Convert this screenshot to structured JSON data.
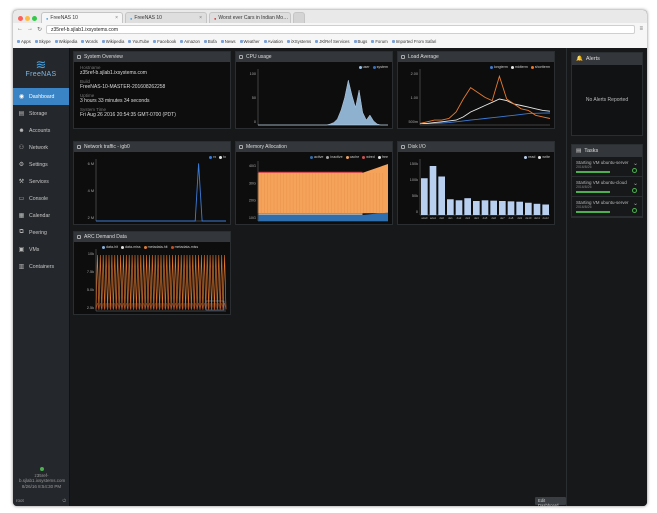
{
  "browser": {
    "tabs": [
      {
        "label": "FreeNAS 10",
        "active": true
      },
      {
        "label": "FreeNAS 10",
        "active": false
      },
      {
        "label": "Worst ever Cars in Indian Mo…",
        "active": false
      }
    ],
    "url": "z35ref-b.sjlab1.ixsystems.com",
    "bookmarks": [
      "Apps",
      "Skype",
      "Wikipedia",
      "Words",
      "Wikipedia",
      "YouTube",
      "Facebook",
      "Amazon",
      "Bofa",
      "News",
      "Weather",
      "Aviation",
      "iXSystems",
      "JKlRef Services",
      "Bugs",
      "Forum",
      "Imported From Safari"
    ]
  },
  "sidebar": {
    "logo": "FreeNAS",
    "items": [
      {
        "label": "Dashboard",
        "icon": "dashboard-icon",
        "glyph": "◉",
        "active": true
      },
      {
        "label": "Storage",
        "icon": "storage-icon",
        "glyph": "▤"
      },
      {
        "label": "Accounts",
        "icon": "accounts-icon",
        "glyph": "☻"
      },
      {
        "label": "Network",
        "icon": "network-icon",
        "glyph": "⚇"
      },
      {
        "label": "Settings",
        "icon": "settings-icon",
        "glyph": "⚙"
      },
      {
        "label": "Services",
        "icon": "services-icon",
        "glyph": "⚒"
      },
      {
        "label": "Console",
        "icon": "console-icon",
        "glyph": "▭"
      },
      {
        "label": "Calendar",
        "icon": "calendar-icon",
        "glyph": "▦"
      },
      {
        "label": "Peering",
        "icon": "peering-icon",
        "glyph": "⧉"
      },
      {
        "label": "VMs",
        "icon": "vms-icon",
        "glyph": "▣"
      },
      {
        "label": "Containers",
        "icon": "containers-icon",
        "glyph": "▥"
      }
    ],
    "host": "z35ref-b.sjlab1.ixsystems.com",
    "time": "8/26/16  8:54:30 PM",
    "user": "root"
  },
  "overview": {
    "title": "System Overview",
    "hostname_label": "Hostname",
    "hostname": "z35ref-b.sjlab1.ixsystems.com",
    "build_label": "Build",
    "build": "FreeNAS-10-MASTER-201608262258",
    "uptime_label": "Uptime",
    "uptime": "3 hours 33 minutes 34 seconds",
    "systime_label": "System Time",
    "systime": "Fri Aug 26 2016 20:54:35 GMT-0700 (PDT)"
  },
  "widgets": {
    "cpu": "CPU usage",
    "load": "Load Average",
    "net": "Network traffic - igb0",
    "mem": "Memory Allocation",
    "disk": "Disk I/O",
    "arc": "ARC Demand Data"
  },
  "chart_data": [
    {
      "type": "area",
      "title": "CPU usage",
      "series": [
        {
          "name": "user"
        },
        {
          "name": "system"
        }
      ],
      "ytick_labels": [
        "100",
        "50",
        "0"
      ],
      "values": [
        0,
        0,
        0,
        0,
        0,
        0,
        0,
        0,
        0,
        0,
        0,
        0,
        0,
        0,
        0,
        0,
        0,
        0,
        0,
        0,
        2,
        5,
        12,
        30,
        55,
        90,
        60,
        35,
        70,
        25,
        10,
        20,
        8,
        2,
        0,
        0,
        0
      ],
      "color": "#9ec3e6"
    },
    {
      "type": "line",
      "title": "Load Average",
      "series": [
        {
          "name": "longterm",
          "color": "#3d7bd6",
          "values": [
            0.1,
            0.1,
            0.1,
            0.12,
            0.15,
            0.2,
            0.25,
            0.3,
            0.35,
            0.4,
            0.45,
            0.5,
            0.55,
            0.6,
            0.65,
            0.7,
            0.72,
            0.73,
            0.74
          ]
        },
        {
          "name": "midterm",
          "color": "#e8e8e8",
          "values": [
            0.1,
            0.1,
            0.15,
            0.2,
            0.25,
            0.3,
            0.5,
            0.8,
            1.0,
            1.2,
            1.4,
            1.6,
            1.5,
            1.3,
            1.2,
            1.1,
            1.0,
            0.9,
            0.85
          ]
        },
        {
          "name": "shortterm",
          "color": "#e67a2e",
          "values": [
            0.1,
            0.2,
            0.3,
            0.3,
            0.4,
            0.8,
            1.6,
            2.3,
            2.0,
            1.7,
            1.5,
            3.0,
            1.6,
            1.3,
            1.0,
            0.9,
            0.6,
            0.5,
            0.4
          ]
        }
      ],
      "ytick_labels": [
        "2.00",
        "1.00",
        "500m"
      ]
    },
    {
      "type": "line",
      "title": "Network traffic - igb0",
      "series": [
        {
          "name": "rx"
        },
        {
          "name": "tx"
        }
      ],
      "ytick_labels": [
        "6 M",
        "4 M",
        "2 M"
      ],
      "values": [
        0,
        0,
        0,
        0,
        0,
        0,
        0,
        0,
        0,
        0,
        0,
        0,
        0,
        0,
        0,
        0,
        0,
        0,
        0,
        0,
        0,
        0,
        0,
        0,
        0,
        0,
        0,
        0,
        0,
        0,
        6.5,
        0,
        0,
        0,
        0,
        0,
        0,
        0,
        0
      ]
    },
    {
      "type": "area",
      "title": "Memory Allocation",
      "series": [
        {
          "name": "active",
          "color": "#2f6fb0"
        },
        {
          "name": "inactive",
          "color": "#a5a5a5"
        },
        {
          "name": "cache",
          "color": "#f5a25a"
        },
        {
          "name": "wired",
          "color": "#d64f4f"
        },
        {
          "name": "free",
          "color": "#e4e4e4"
        }
      ],
      "ytick_labels": [
        "40G",
        "30G",
        "20G",
        "10G"
      ]
    },
    {
      "type": "bar",
      "title": "Disk I/O",
      "series": [
        {
          "name": "read",
          "color": "#b8cff0"
        },
        {
          "name": "write"
        }
      ],
      "ytick_labels": [
        "150k",
        "100k",
        "50k",
        "0"
      ],
      "values": [
        105,
        140,
        110,
        45,
        42,
        48,
        40,
        42,
        41,
        40,
        39,
        38,
        35,
        32,
        30
      ],
      "categories": [
        "ada0",
        "ada1",
        "da0",
        "da1",
        "da2",
        "da3",
        "da4",
        "da5",
        "da6",
        "da7",
        "da8",
        "da9",
        "da10",
        "da11",
        "da12"
      ],
      "ylim": [
        0,
        160
      ]
    },
    {
      "type": "line",
      "title": "ARC Demand Data",
      "series": [
        {
          "name": "data-hit",
          "color": "#8ab0e0"
        },
        {
          "name": "data-miss",
          "color": "#e0e0e0"
        },
        {
          "name": "metadata-hit",
          "color": "#e67a2e"
        },
        {
          "name": "metadata-miss",
          "color": "#b9522a"
        }
      ],
      "ytick_labels": [
        "10k",
        "7.5k",
        "5.0k",
        "2.5k"
      ]
    }
  ],
  "alerts": {
    "title": "Alerts",
    "empty": "No Alerts Reported"
  },
  "tasks": {
    "title": "Tasks",
    "items": [
      {
        "name": "Starting VM ubuntu-server",
        "meta": "2016/8/26"
      },
      {
        "name": "Starting VM ubuntu-cloud",
        "meta": "2016/8/26"
      },
      {
        "name": "Starting VM ubuntu-server",
        "meta": "2016/8/26"
      }
    ]
  },
  "footer": {
    "edit_dashboard": "Edit Dashboard",
    "collapse": "›"
  }
}
